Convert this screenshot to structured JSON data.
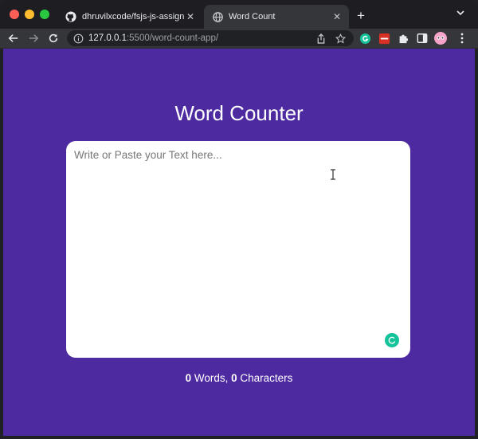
{
  "browser": {
    "tabs": [
      {
        "label": "dhruvilxcode/fsjs-js-assignment",
        "icon": "github-icon",
        "active": false
      },
      {
        "label": "Word Count",
        "icon": "globe-icon",
        "active": true
      }
    ],
    "url_host": "127.0.0.1",
    "url_path": ":5500/word-count-app/"
  },
  "page": {
    "title": "Word Counter",
    "textarea_placeholder": "Write or Paste your Text here...",
    "textarea_value": "",
    "word_count": "0",
    "words_label": " Words, ",
    "char_count": "0",
    "chars_label": " Characters"
  },
  "colors": {
    "background": "#4d2aa0",
    "text_box": "#ffffff",
    "grammarly": "#15c39a"
  }
}
